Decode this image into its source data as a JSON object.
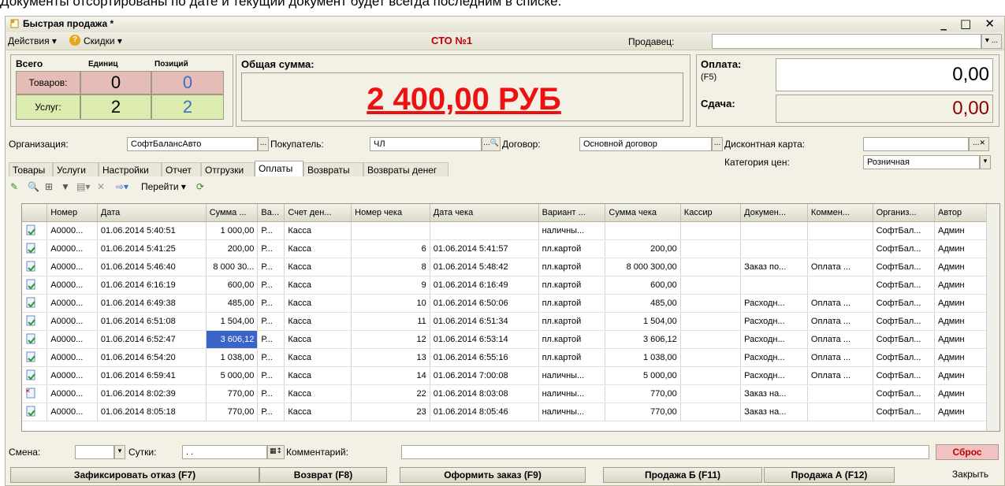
{
  "top_text": "Документы отсортированы по дате и текущий документ будет всегда последним в списке.",
  "window": {
    "title": "Быстрая продажа *",
    "controls": "_ □ ✕"
  },
  "menu": {
    "actions": "Действия ▾",
    "help": "?",
    "discounts": "Скидки ▾",
    "center_title": "СТО №1",
    "seller_label": "Продавец:",
    "seller_value": "",
    "seller_btn": "▾ ..."
  },
  "summary": {
    "total_label": "Всего",
    "units_label": "Единиц",
    "positions_label": "Позиций",
    "goods_label": "Товаров:",
    "services_label": "Услуг:",
    "goods_units": "0",
    "goods_positions": "0",
    "services_units": "2",
    "services_positions": "2",
    "sum_label": "Общая сумма:",
    "sum_value": "2 400,00 РУБ",
    "payment_label": "Оплата:",
    "payment_hotkey": "(F5)",
    "payment_value": "0,00",
    "change_label": "Сдача:",
    "change_value": "0,00"
  },
  "fields": {
    "org_label": "Организация:",
    "org_value": "СофтБалансАвто",
    "buyer_label": "Покупатель:",
    "buyer_value": "ЧЛ",
    "contract_label": "Договор:",
    "contract_value": "Основной договор",
    "card_label": "Дисконтная карта:",
    "card_value": "",
    "price_cat_label": "Категория цен:",
    "price_cat_value": "Розничная"
  },
  "tabs": [
    "Товары",
    "Услуги",
    "Настройки",
    "Отчет",
    "Отгрузки",
    "Оплаты",
    "Возвраты",
    "Возвраты денег"
  ],
  "active_tab": 5,
  "toolbar": {
    "goto_label": "Перейти ▾"
  },
  "table": {
    "headers": [
      "Номер",
      "Дата",
      "Сумма ...",
      "Ва...",
      "Счет ден...",
      "Номер чека",
      "Дата чека",
      "Вариант ...",
      "Сумма чека",
      "Кассир",
      "Докумен...",
      "Коммен...",
      "Организ...",
      "Автор"
    ],
    "rows": [
      [
        "A0000...",
        "01.06.2014 5:40:51",
        "1 000,00",
        "Р...",
        "Касса",
        "",
        "",
        "наличны...",
        "",
        "",
        "",
        "",
        "СофтБал...",
        "Админ"
      ],
      [
        "A0000...",
        "01.06.2014 5:41:25",
        "200,00",
        "Р...",
        "Касса",
        "6",
        "01.06.2014 5:41:57",
        "пл.картой",
        "200,00",
        "",
        "",
        "",
        "СофтБал...",
        "Админ"
      ],
      [
        "A0000...",
        "01.06.2014 5:46:40",
        "8 000 30...",
        "Р...",
        "Касса",
        "8",
        "01.06.2014 5:48:42",
        "пл.картой",
        "8 000 300,00",
        "",
        "Заказ по...",
        "Оплата ...",
        "СофтБал...",
        "Админ"
      ],
      [
        "A0000...",
        "01.06.2014 6:16:19",
        "600,00",
        "Р...",
        "Касса",
        "9",
        "01.06.2014 6:16:49",
        "пл.картой",
        "600,00",
        "",
        "",
        "",
        "СофтБал...",
        "Админ"
      ],
      [
        "A0000...",
        "01.06.2014 6:49:38",
        "485,00",
        "Р...",
        "Касса",
        "10",
        "01.06.2014 6:50:06",
        "пл.картой",
        "485,00",
        "",
        "Расходн...",
        "Оплата ...",
        "СофтБал...",
        "Админ"
      ],
      [
        "A0000...",
        "01.06.2014 6:51:08",
        "1 504,00",
        "Р...",
        "Касса",
        "11",
        "01.06.2014 6:51:34",
        "пл.картой",
        "1 504,00",
        "",
        "Расходн...",
        "Оплата ...",
        "СофтБал...",
        "Админ"
      ],
      [
        "A0000...",
        "01.06.2014 6:52:47",
        "3 606,12",
        "Р...",
        "Касса",
        "12",
        "01.06.2014 6:53:14",
        "пл.картой",
        "3 606,12",
        "",
        "Расходн...",
        "Оплата ...",
        "СофтБал...",
        "Админ"
      ],
      [
        "A0000...",
        "01.06.2014 6:54:20",
        "1 038,00",
        "Р...",
        "Касса",
        "13",
        "01.06.2014 6:55:16",
        "пл.картой",
        "1 038,00",
        "",
        "Расходн...",
        "Оплата ...",
        "СофтБал...",
        "Админ"
      ],
      [
        "A0000...",
        "01.06.2014 6:59:41",
        "5 000,00",
        "Р...",
        "Касса",
        "14",
        "01.06.2014 7:00:08",
        "наличны...",
        "5 000,00",
        "",
        "Расходн...",
        "Оплата ...",
        "СофтБал...",
        "Админ"
      ],
      [
        "A0000...",
        "01.06.2014 8:02:39",
        "770,00",
        "Р...",
        "Касса",
        "22",
        "01.06.2014 8:03:08",
        "наличны...",
        "770,00",
        "",
        "Заказ на...",
        "",
        "СофтБал...",
        "Админ"
      ],
      [
        "A0000...",
        "01.06.2014 8:05:18",
        "770,00",
        "Р...",
        "Касса",
        "23",
        "01.06.2014 8:05:46",
        "наличны...",
        "770,00",
        "",
        "Заказ на...",
        "",
        "СофтБал...",
        "Админ"
      ]
    ]
  },
  "bottom": {
    "shift_label": "Смена:",
    "days_label": "Сутки:",
    "days_value": ". .",
    "comment_label": "Комментарий:",
    "reset_label": "Сброс"
  },
  "buttons": {
    "refuse": "Зафиксировать отказ  (F7)",
    "return": "Возврат  (F8)",
    "order": "Оформить заказ  (F9)",
    "sale_b": "Продажа Б  (F11)",
    "sale_a": "Продажа А  (F12)",
    "close": "Закрыть"
  },
  "colors": {
    "sum_red": "#ee1111",
    "change_red": "#8b0000",
    "goods_bg": "#e5bcb6",
    "services_bg": "#dcecae",
    "reset_bg": "#f2c2c2"
  }
}
